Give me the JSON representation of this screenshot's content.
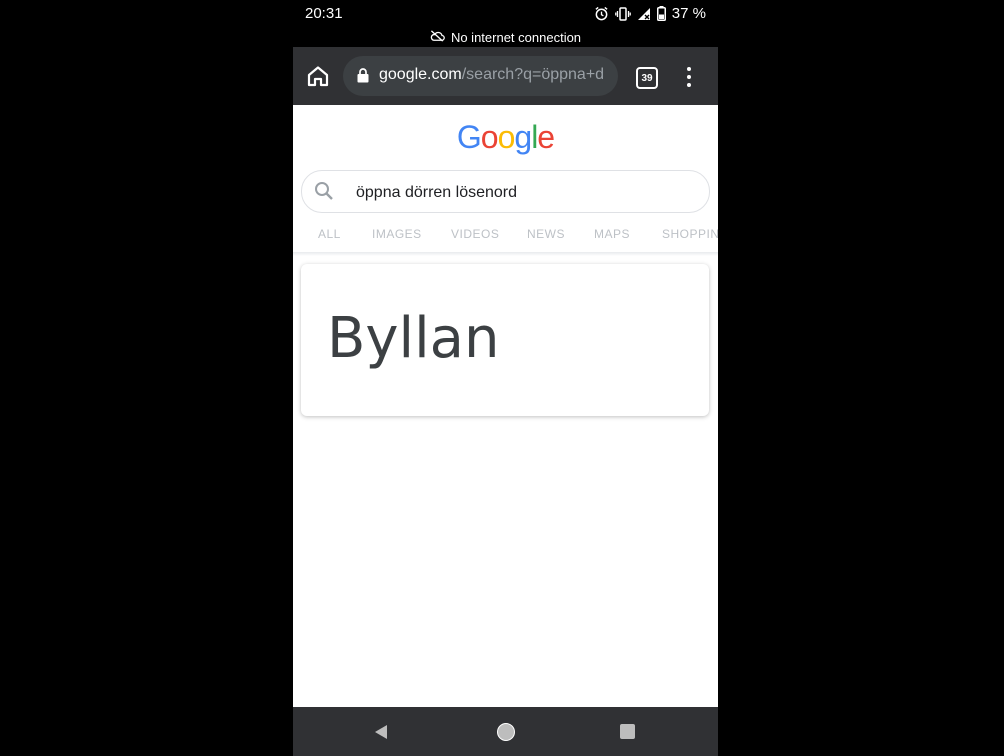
{
  "status_bar": {
    "time": "20:31",
    "battery": "37 %",
    "icons": [
      "alarm-icon",
      "vibrate-icon",
      "no-signal-icon",
      "battery-icon"
    ]
  },
  "connection_notice": "No internet connection",
  "toolbar": {
    "url_domain": "google.com",
    "url_path": "/search?q=öppna+d",
    "tab_count": "39",
    "icons": [
      "home-icon",
      "lock-icon",
      "tab-switcher-icon",
      "menu-icon"
    ]
  },
  "google_logo": {
    "letters": [
      {
        "char": "G",
        "color": "#4285F4"
      },
      {
        "char": "o",
        "color": "#EA4335"
      },
      {
        "char": "o",
        "color": "#FBBC05"
      },
      {
        "char": "g",
        "color": "#4285F4"
      },
      {
        "char": "l",
        "color": "#34A853"
      },
      {
        "char": "e",
        "color": "#EA4335"
      }
    ]
  },
  "search": {
    "query": "öppna dörren lösenord"
  },
  "search_tabs": [
    "ALL",
    "IMAGES",
    "VIDEOS",
    "NEWS",
    "MAPS",
    "SHOPPING"
  ],
  "answer": {
    "text": "Byllan"
  },
  "navigation": {
    "icons": [
      "back-icon",
      "home-icon",
      "recents-icon"
    ]
  },
  "colors": {
    "toolbar_bg": "#303134",
    "tab_inactive": "#bdc1c6"
  }
}
